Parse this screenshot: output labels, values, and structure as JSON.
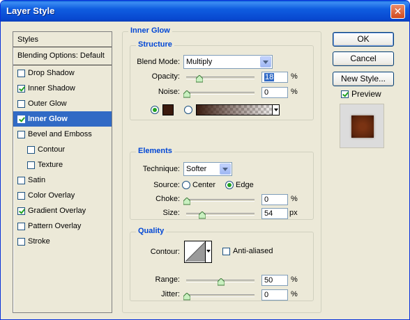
{
  "window": {
    "title": "Layer Style",
    "close": "✕"
  },
  "styles_panel": {
    "header": "Styles",
    "blending": "Blending Options: Default",
    "items": [
      {
        "label": "Drop Shadow",
        "checked": false,
        "selected": false,
        "sub": false
      },
      {
        "label": "Inner Shadow",
        "checked": true,
        "selected": false,
        "sub": false
      },
      {
        "label": "Outer Glow",
        "checked": false,
        "selected": false,
        "sub": false
      },
      {
        "label": "Inner Glow",
        "checked": true,
        "selected": true,
        "sub": false
      },
      {
        "label": "Bevel and Emboss",
        "checked": false,
        "selected": false,
        "sub": false
      },
      {
        "label": "Contour",
        "checked": false,
        "selected": false,
        "sub": true
      },
      {
        "label": "Texture",
        "checked": false,
        "selected": false,
        "sub": true
      },
      {
        "label": "Satin",
        "checked": false,
        "selected": false,
        "sub": false
      },
      {
        "label": "Color Overlay",
        "checked": false,
        "selected": false,
        "sub": false
      },
      {
        "label": "Gradient Overlay",
        "checked": true,
        "selected": false,
        "sub": false
      },
      {
        "label": "Pattern Overlay",
        "checked": false,
        "selected": false,
        "sub": false
      },
      {
        "label": "Stroke",
        "checked": false,
        "selected": false,
        "sub": false
      }
    ]
  },
  "inner_glow": {
    "title": "Inner Glow",
    "structure": {
      "title": "Structure",
      "blend_mode_label": "Blend Mode:",
      "blend_mode_value": "Multiply",
      "opacity_label": "Opacity:",
      "opacity_value": "18",
      "opacity_unit": "%",
      "noise_label": "Noise:",
      "noise_value": "0",
      "noise_unit": "%",
      "color_swatch": "#3b1a0e",
      "opacity_level": 0.18,
      "noise_level": 0.0
    },
    "elements": {
      "title": "Elements",
      "technique_label": "Technique:",
      "technique_value": "Softer",
      "source_label": "Source:",
      "source_center": "Center",
      "source_edge": "Edge",
      "choke_label": "Choke:",
      "choke_value": "0",
      "choke_unit": "%",
      "size_label": "Size:",
      "size_value": "54",
      "size_unit": "px",
      "choke_level": 0.0,
      "size_level": 0.22
    },
    "quality": {
      "title": "Quality",
      "contour_label": "Contour:",
      "anti_aliased_label": "Anti-aliased",
      "range_label": "Range:",
      "range_value": "50",
      "range_unit": "%",
      "jitter_label": "Jitter:",
      "jitter_value": "0",
      "jitter_unit": "%",
      "range_level": 0.5,
      "jitter_level": 0.0
    }
  },
  "buttons": {
    "ok": "OK",
    "cancel": "Cancel",
    "new_style": "New Style...",
    "preview_label": "Preview"
  }
}
